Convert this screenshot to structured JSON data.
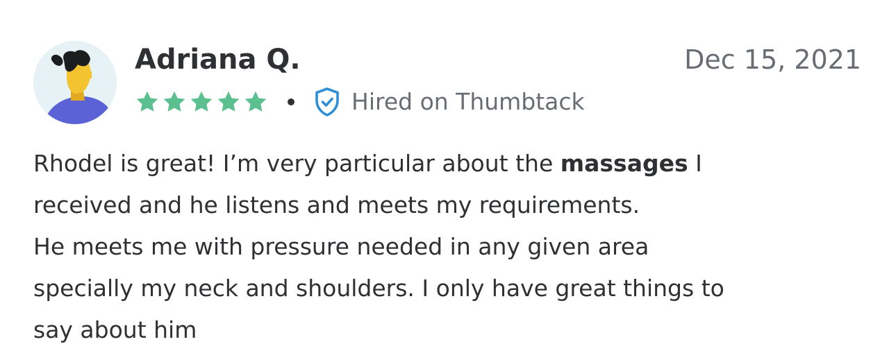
{
  "review": {
    "reviewer_name": "Adriana Q.",
    "date": "Dec 15, 2021",
    "rating": 5,
    "rating_max": 5,
    "hired_label": "Hired on Thumbtack",
    "text": {
      "line1_before": "Rhodel is great! I’m very particular about the ",
      "line1_bold": "massages",
      "line1_after": " I",
      "line2": "received and he listens and meets my requirements.",
      "line3": "He meets me with pressure needed in any given area",
      "line4": "specially my neck and shoulders. I only have great things to",
      "line5": "say about him"
    }
  },
  "icons": {
    "avatar": "avatar-illustration",
    "star": "star-icon",
    "badge": "shield-check-icon"
  },
  "colors": {
    "star": "#5bbf8f",
    "shield": "#2f8fd6",
    "text": "#2f3033",
    "muted": "#676d73",
    "avatar_bg": "#e6f2f5",
    "avatar_shirt": "#5a62d6",
    "avatar_skin": "#f4c430"
  }
}
